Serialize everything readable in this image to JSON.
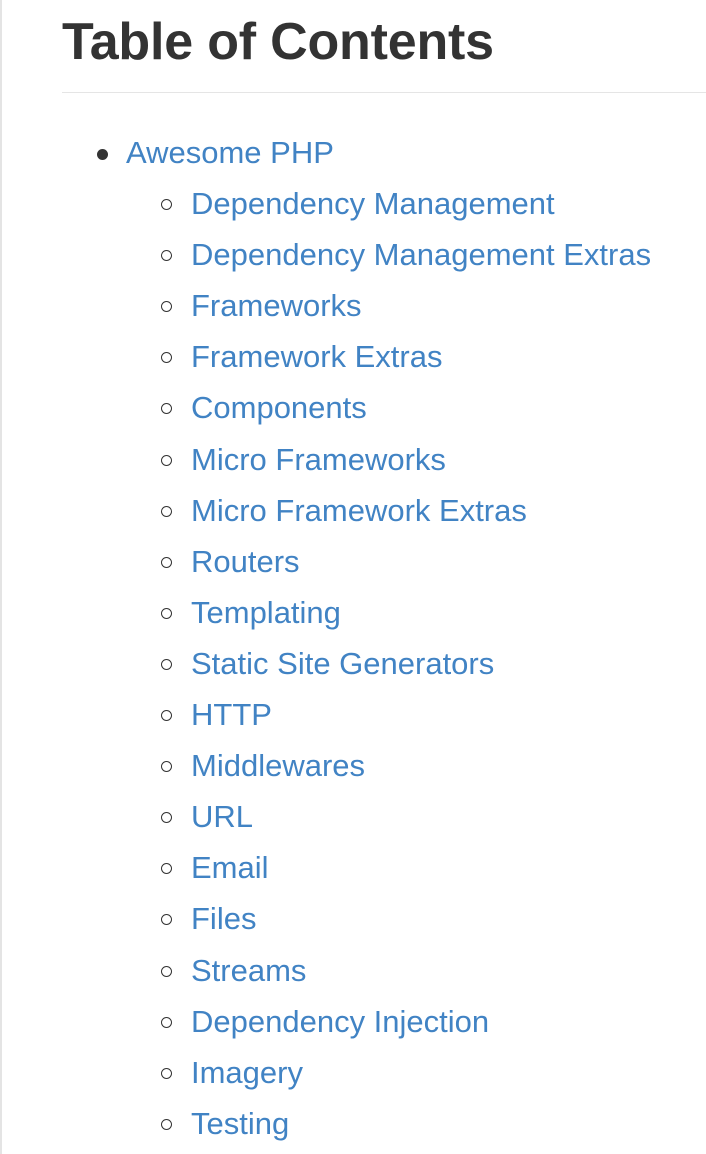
{
  "heading": "Table of Contents",
  "toc": {
    "top_item": "Awesome PHP",
    "sub_items": [
      "Dependency Management",
      "Dependency Management Extras",
      "Frameworks",
      "Framework Extras",
      "Components",
      "Micro Frameworks",
      "Micro Framework Extras",
      "Routers",
      "Templating",
      "Static Site Generators",
      "HTTP",
      "Middlewares",
      "URL",
      "Email",
      "Files",
      "Streams",
      "Dependency Injection",
      "Imagery",
      "Testing"
    ]
  },
  "colors": {
    "link": "#4183c4",
    "heading": "#333333",
    "rule": "#e5e5e5"
  }
}
